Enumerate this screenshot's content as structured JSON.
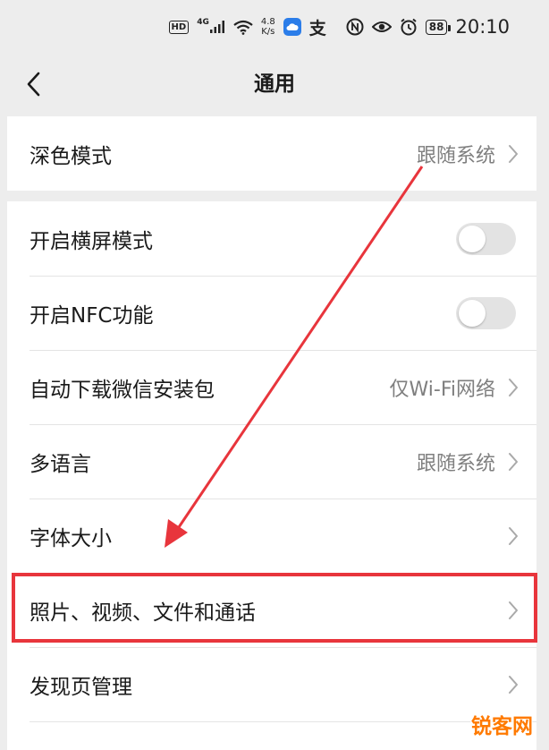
{
  "status_bar": {
    "hd": "HD",
    "network": "4G",
    "speed_value": "4.8",
    "speed_unit": "K/s",
    "ali_glyph": "支",
    "battery": "88",
    "time": "20:10"
  },
  "nav": {
    "title": "通用",
    "back_icon": "chevron-left-icon"
  },
  "groups": [
    {
      "rows": [
        {
          "label": "深色模式",
          "value": "跟随系统",
          "kind": "link"
        }
      ]
    },
    {
      "rows": [
        {
          "label": "开启横屏模式",
          "kind": "toggle",
          "on": false
        },
        {
          "label": "开启NFC功能",
          "kind": "toggle",
          "on": false
        },
        {
          "label": "自动下载微信安装包",
          "value": "仅Wi-Fi网络",
          "kind": "link"
        },
        {
          "label": "多语言",
          "value": "跟随系统",
          "kind": "link"
        },
        {
          "label": "字体大小",
          "kind": "link"
        },
        {
          "label": "照片、视频、文件和通话",
          "kind": "link",
          "highlighted": true
        },
        {
          "label": "发现页管理",
          "kind": "link"
        }
      ]
    }
  ],
  "annotation": {
    "highlight_color": "#e8353c",
    "arrow_color": "#e8353c"
  },
  "watermark": "锐客网",
  "colors": {
    "background": "#ededed",
    "card": "#ffffff",
    "value_text": "#7f7f7f",
    "toggle_off": "#e3e3e3"
  }
}
